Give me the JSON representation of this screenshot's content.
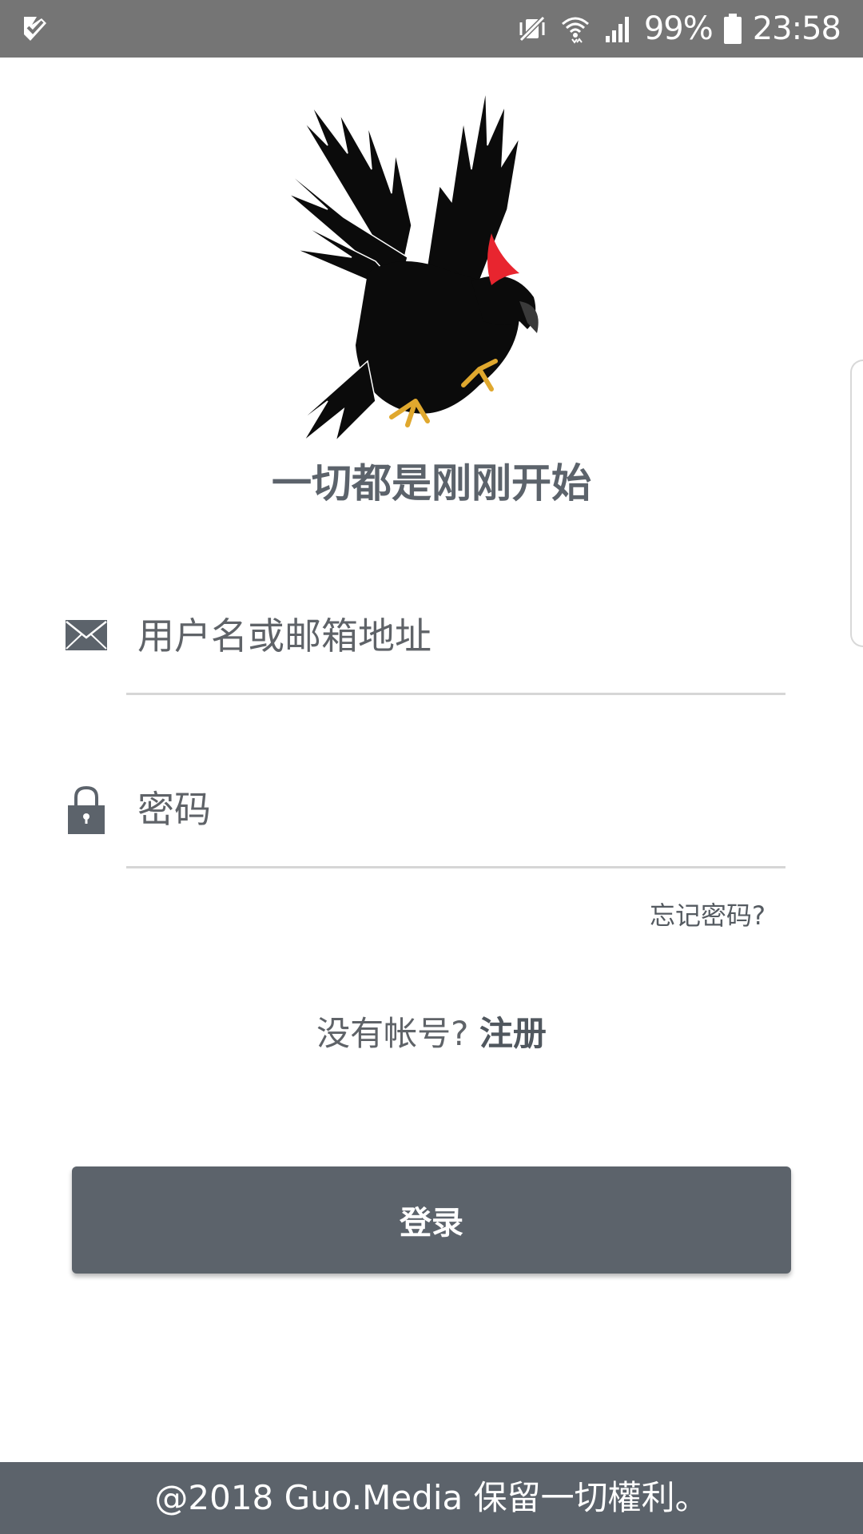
{
  "status_bar": {
    "battery_percent": "99%",
    "time": "23:58",
    "icons": [
      "check-notification-icon",
      "mute-vibrate-icon",
      "wifi-icon",
      "cellular-signal-icon",
      "battery-icon"
    ]
  },
  "logo": {
    "name": "eagle-logo-icon"
  },
  "tagline": "一切都是刚刚开始",
  "form": {
    "username_placeholder": "用户名或邮箱地址",
    "username_value": "",
    "password_placeholder": "密码",
    "password_value": "",
    "forgot_password": "忘记密码?"
  },
  "register": {
    "prompt": "没有帐号?",
    "link": "注册"
  },
  "login_button": "登录",
  "footer": "@2018 Guo.Media 保留一切權利。",
  "colors": {
    "status_bar": "#757575",
    "primary": "#5c636b",
    "background": "#ffffff",
    "underline": "#d6d6d6",
    "accent_red": "#e8252f",
    "talon_gold": "#e0a82e"
  }
}
